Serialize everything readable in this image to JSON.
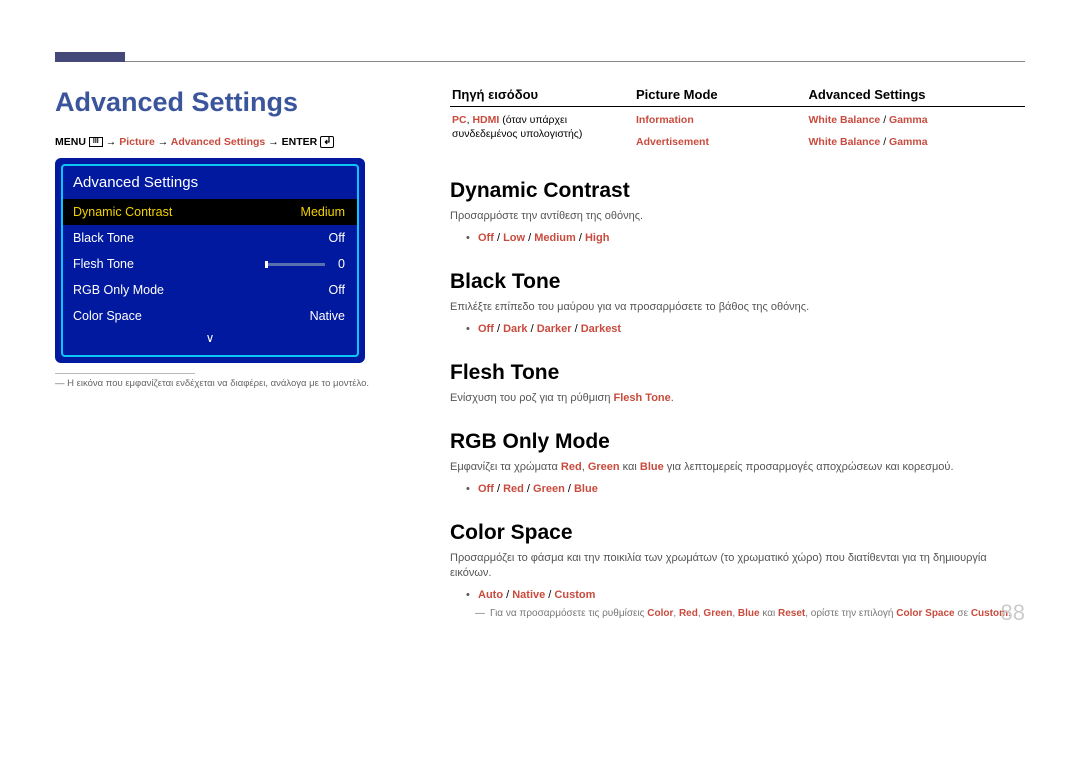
{
  "title": "Advanced Settings",
  "breadcrumb": {
    "menu": "MENU",
    "arrow": " → ",
    "picture": "Picture",
    "adv": "Advanced Settings",
    "enter": "ENTER"
  },
  "osd": {
    "title": "Advanced Settings",
    "rows": [
      {
        "label": "Dynamic Contrast",
        "value": "Medium",
        "selected": true
      },
      {
        "label": "Black Tone",
        "value": "Off"
      },
      {
        "label": "Flesh Tone",
        "value": "0",
        "slider": true
      },
      {
        "label": "RGB Only Mode",
        "value": "Off"
      },
      {
        "label": "Color Space",
        "value": "Native"
      }
    ],
    "down_arrow": "∨"
  },
  "left_footnote": "Η εικόνα που εμφανίζεται ενδέχεται να διαφέρει, ανάλογα με το μοντέλο.",
  "table": {
    "headers": [
      "Πηγή εισόδου",
      "Picture Mode",
      "Advanced Settings"
    ],
    "row1": {
      "c1_red": "PC",
      "c1_sep": ", ",
      "c1_red2": "HDMI",
      "c1_plain": " (όταν υπάρχει συνδεδεμένος υπολογιστής)",
      "c2a": "Information",
      "c3a_1": "White Balance",
      "c3a_sep": " / ",
      "c3a_2": "Gamma",
      "c2b": "Advertisement",
      "c3b_1": "White Balance",
      "c3b_sep": " / ",
      "c3b_2": "Gamma"
    }
  },
  "sections": {
    "dynamic": {
      "title": "Dynamic Contrast",
      "desc": "Προσαρμόστε την αντίθεση της οθόνης.",
      "opts": [
        "Off",
        "Low",
        "Medium",
        "High"
      ]
    },
    "black": {
      "title": "Black Tone",
      "desc": "Επιλέξτε επίπεδο του μαύρου για να προσαρμόσετε το βάθος της οθόνης.",
      "opts": [
        "Off",
        "Dark",
        "Darker",
        "Darkest"
      ]
    },
    "flesh": {
      "title": "Flesh Tone",
      "desc_pre": "Ενίσχυση του ροζ για τη ρύθμιση ",
      "desc_red": "Flesh Tone",
      "desc_post": "."
    },
    "rgb": {
      "title": "RGB Only Mode",
      "desc_pre": "Εμφανίζει τα χρώματα ",
      "desc_r": "Red",
      "desc_s1": ", ",
      "desc_g": "Green",
      "desc_s2": " και ",
      "desc_b": "Blue",
      "desc_post": " για λεπτομερείς προσαρμογές αποχρώσεων και κορεσμού.",
      "opts": [
        "Off",
        "Red",
        "Green",
        "Blue"
      ]
    },
    "cspace": {
      "title": "Color Space",
      "desc": "Προσαρμόζει το φάσμα και την ποικιλία των χρωμάτων (το χρωματικό χώρο) που διατίθενται για τη δημιουργία εικόνων.",
      "opts": [
        "Auto",
        "Native",
        "Custom"
      ],
      "note_pre": "Για να προσαρμόσετε τις ρυθμίσεις ",
      "note_c": "Color",
      "note_s": ", ",
      "note_r": "Red",
      "note_g": "Green",
      "note_b": "Blue",
      "note_and": " και ",
      "note_reset": "Reset",
      "note_mid": ", ορίστε την επιλογή ",
      "note_cs": "Color Space",
      "note_to": " σε ",
      "note_custom": "Custom",
      "note_end": "."
    }
  },
  "page_number": "88",
  "slash": " / "
}
